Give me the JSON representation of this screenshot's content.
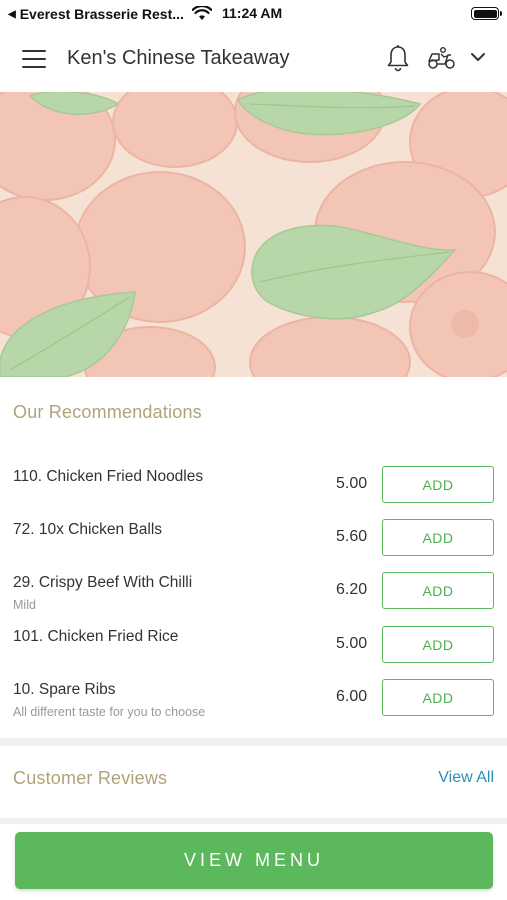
{
  "status_bar": {
    "back_app": "Everest Brasserie Rest...",
    "time": "11:24 AM",
    "battery_level": 1.0
  },
  "header": {
    "title": "Ken's Chinese Takeaway",
    "icons": [
      "menu-icon",
      "bell-icon",
      "delivery-scooter-icon",
      "chevron-down-icon"
    ]
  },
  "recommendations": {
    "title": "Our Recommendations",
    "items": [
      {
        "name": "110. Chicken Fried Noodles",
        "desc": "",
        "price": "5.00",
        "button": "ADD"
      },
      {
        "name": "72. 10x Chicken Balls",
        "desc": "",
        "price": "5.60",
        "button": "ADD"
      },
      {
        "name": "29. Crispy Beef With Chilli",
        "desc": "Mild",
        "price": "6.20",
        "button": "ADD"
      },
      {
        "name": "101. Chicken Fried Rice",
        "desc": "",
        "price": "5.00",
        "button": "ADD"
      },
      {
        "name": "10. Spare Ribs",
        "desc": "All different taste for you to choose",
        "price": "6.00",
        "button": "ADD"
      }
    ]
  },
  "reviews": {
    "title": "Customer Reviews",
    "view_all": "View All"
  },
  "footer": {
    "view_menu": "VIEW MENU"
  },
  "colors": {
    "accent_green": "#5cb85c",
    "section_title": "#b0a27a",
    "link_blue": "#2b8fb5"
  }
}
